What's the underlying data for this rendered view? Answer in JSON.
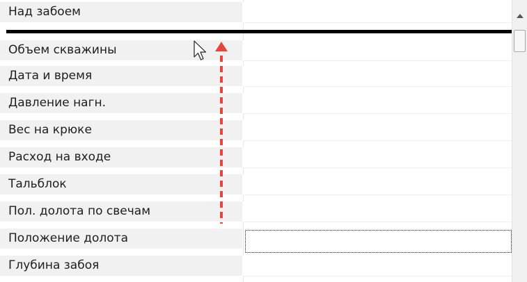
{
  "rows": [
    {
      "label": "Над забоем"
    },
    {
      "label": "Объем скважины"
    },
    {
      "label": "Дата и время"
    },
    {
      "label": "Давление нагн."
    },
    {
      "label": "Вес на крюке"
    },
    {
      "label": "Расход на входе"
    },
    {
      "label": "Тальблок"
    },
    {
      "label": "Пол. долота по свечам"
    },
    {
      "label": "Положение долота"
    },
    {
      "label": "Глубина забоя"
    }
  ],
  "colors": {
    "label_bg": "#f1f1f1",
    "drop_indicator": "#000000",
    "drag_arrow": "#e8453c"
  },
  "icons": {
    "cursor": "mouse-pointer-icon",
    "drag_arrow": "dashed-up-arrow-icon",
    "scroll_up": "triangle-up-icon"
  }
}
